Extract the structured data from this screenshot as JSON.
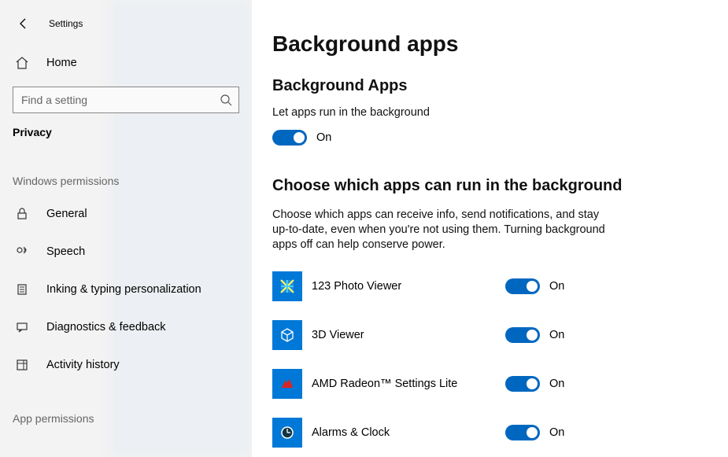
{
  "header": {
    "settings_label": "Settings"
  },
  "sidebar": {
    "home_label": "Home",
    "search_placeholder": "Find a setting",
    "privacy_label": "Privacy",
    "section_win_perms": "Windows permissions",
    "section_app_perms": "App permissions",
    "items": {
      "general": "General",
      "speech": "Speech",
      "inking": "Inking & typing personalization",
      "diagnostics": "Diagnostics & feedback",
      "activity": "Activity history"
    }
  },
  "main": {
    "title": "Background apps",
    "section1_title": "Background Apps",
    "section1_desc": "Let apps run in the background",
    "master_toggle_state": "On",
    "section2_title": "Choose which apps can run in the background",
    "section2_desc": "Choose which apps can receive info, send notifications, and stay up-to-date, even when you're not using them. Turning background apps off can help conserve power.",
    "apps": [
      {
        "name": "123 Photo Viewer",
        "state": "On"
      },
      {
        "name": "3D Viewer",
        "state": "On"
      },
      {
        "name": "AMD Radeon™ Settings Lite",
        "state": "On"
      },
      {
        "name": "Alarms & Clock",
        "state": "On"
      }
    ]
  }
}
